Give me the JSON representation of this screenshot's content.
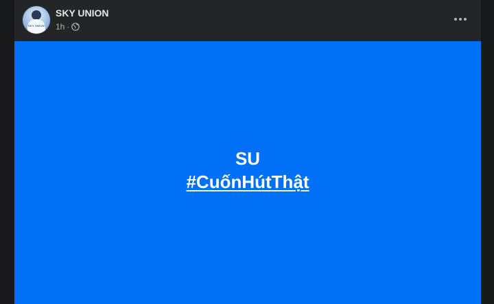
{
  "post": {
    "author": "SKY UNION",
    "time": "1h",
    "separator": "·",
    "audience_icon": "globe-icon",
    "more_icon": "more-options-icon",
    "avatar_text": "SKY UNION",
    "banner": {
      "line1": "SU",
      "hashtag": "#CuốnHútThật",
      "background_color": "#0070f7",
      "text_color": "#ffffff"
    }
  }
}
